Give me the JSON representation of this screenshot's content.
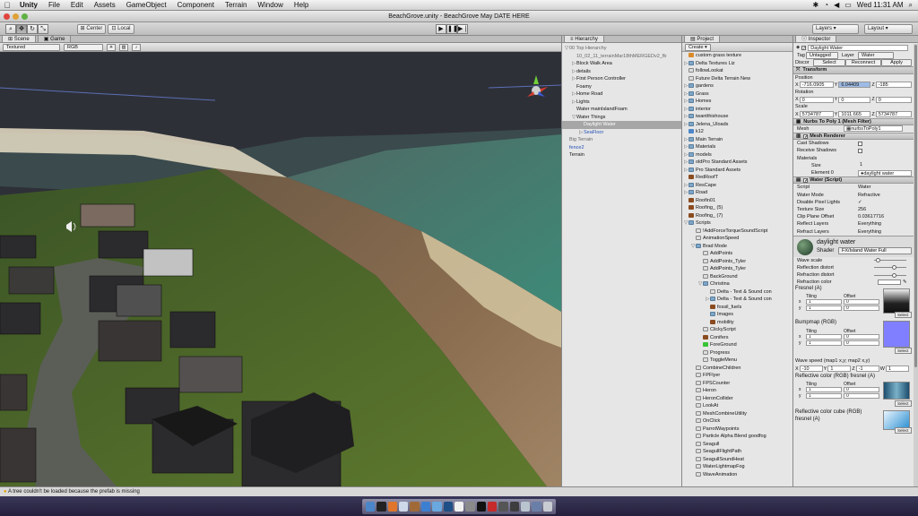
{
  "menubar": {
    "app": "Unity",
    "items": [
      "File",
      "Edit",
      "Assets",
      "GameObject",
      "Component",
      "Terrain",
      "Window",
      "Help"
    ],
    "clock": "Wed 11:31 AM"
  },
  "window": {
    "title": "BeachGrove.unity - BeachGrove May DATE HERE"
  },
  "toolbar": {
    "pivot": "Center",
    "space": "Local",
    "layers": "Layers",
    "layout": "Layout"
  },
  "scene": {
    "tabs": [
      "Scene",
      "Game"
    ],
    "draw_mode": "Textured",
    "render_mode": "RGB"
  },
  "hierarchy": {
    "title": "Hierarchy",
    "items": [
      {
        "text": "00 Top Hierarchy",
        "fold": "▽",
        "style": "gray",
        "indent": 0
      },
      {
        "text": "10_02_11_terrainMar18thMERGEDv2_fb",
        "fold": "",
        "style": "gray",
        "indent": 1
      },
      {
        "text": "Block Walk Area",
        "fold": "▷",
        "style": "",
        "indent": 1
      },
      {
        "text": "details",
        "fold": "▷",
        "style": "",
        "indent": 1
      },
      {
        "text": "First Person Controller",
        "fold": "▷",
        "style": "",
        "indent": 1
      },
      {
        "text": "Foamy",
        "fold": "",
        "style": "",
        "indent": 1
      },
      {
        "text": "Home Road",
        "fold": "▷",
        "style": "",
        "indent": 1
      },
      {
        "text": "Lights",
        "fold": "▷",
        "style": "",
        "indent": 1
      },
      {
        "text": "Water mainIslandFoam",
        "fold": "",
        "style": "",
        "indent": 1
      },
      {
        "text": "Water Things",
        "fold": "▽",
        "style": "",
        "indent": 1
      },
      {
        "text": "Daylight Water",
        "fold": "",
        "style": "sel",
        "indent": 2
      },
      {
        "text": "SeaFloor",
        "fold": "▷",
        "style": "blue",
        "indent": 2
      },
      {
        "text": "Big Terrain",
        "fold": "",
        "style": "gray",
        "indent": 0
      },
      {
        "text": "fence2",
        "fold": "",
        "style": "blue",
        "indent": 0
      },
      {
        "text": "Terrain",
        "fold": "",
        "style": "",
        "indent": 0
      }
    ]
  },
  "project": {
    "title": "Project",
    "create": "Create ▾",
    "items": [
      {
        "text": "custom grass texture",
        "fold": "",
        "icon": "tex",
        "indent": 0
      },
      {
        "text": "Delta Textures Liz",
        "fold": "▷",
        "icon": "folder",
        "indent": 0
      },
      {
        "text": "followLookat",
        "fold": "",
        "icon": "js",
        "indent": 0
      },
      {
        "text": "Future Delta Terrain New",
        "fold": "",
        "icon": "js",
        "indent": 0
      },
      {
        "text": "gardens",
        "fold": "▷",
        "icon": "folder",
        "indent": 0
      },
      {
        "text": "Grass",
        "fold": "▷",
        "icon": "folder",
        "indent": 0
      },
      {
        "text": "Homes",
        "fold": "▷",
        "icon": "folder",
        "indent": 0
      },
      {
        "text": "interior",
        "fold": "▷",
        "icon": "folder",
        "indent": 0
      },
      {
        "text": "iwantthishouse",
        "fold": "▷",
        "icon": "folder",
        "indent": 0
      },
      {
        "text": "Jelena_Uloads",
        "fold": "▷",
        "icon": "folder",
        "indent": 0
      },
      {
        "text": "k12",
        "fold": "",
        "icon": "pre",
        "indent": 0
      },
      {
        "text": "Main Terrain",
        "fold": "▷",
        "icon": "folder",
        "indent": 0
      },
      {
        "text": "Materials",
        "fold": "▷",
        "icon": "folder",
        "indent": 0
      },
      {
        "text": "models",
        "fold": "▷",
        "icon": "folder",
        "indent": 0
      },
      {
        "text": "oldPro Standard Assets",
        "fold": "▷",
        "icon": "folder",
        "indent": 0
      },
      {
        "text": "Pro Standard Assets",
        "fold": "▷",
        "icon": "folder",
        "indent": 0
      },
      {
        "text": "RedRoofT",
        "fold": "",
        "icon": "tex2",
        "indent": 0
      },
      {
        "text": "ResCape",
        "fold": "▷",
        "icon": "folder",
        "indent": 0
      },
      {
        "text": "Road",
        "fold": "▷",
        "icon": "folder",
        "indent": 0
      },
      {
        "text": "Roofin01",
        "fold": "",
        "icon": "tex2",
        "indent": 0
      },
      {
        "text": "Roofing_ (5)",
        "fold": "",
        "icon": "tex2",
        "indent": 0
      },
      {
        "text": "Roofing_ (7)",
        "fold": "",
        "icon": "tex2",
        "indent": 0
      },
      {
        "text": "Scripts",
        "fold": "▽",
        "icon": "folder",
        "indent": 0
      },
      {
        "text": "!AddForceTorqueSoundScript",
        "fold": "",
        "icon": "js",
        "indent": 1
      },
      {
        "text": "AnimationSpeed",
        "fold": "",
        "icon": "js",
        "indent": 1
      },
      {
        "text": "Brad Mode",
        "fold": "▽",
        "icon": "folder",
        "indent": 1
      },
      {
        "text": "AddPoints",
        "fold": "",
        "icon": "js",
        "indent": 2
      },
      {
        "text": "AddPoints_Tyler",
        "fold": "",
        "icon": "js",
        "indent": 2
      },
      {
        "text": "AddPoints_Tyler",
        "fold": "",
        "icon": "js",
        "indent": 2
      },
      {
        "text": "BackGround",
        "fold": "",
        "icon": "js",
        "indent": 2
      },
      {
        "text": "Christina",
        "fold": "▽",
        "icon": "folder",
        "indent": 2
      },
      {
        "text": "Delta - Text & Sound con",
        "fold": "",
        "icon": "js",
        "indent": 3
      },
      {
        "text": "Delta - Text & Sound con",
        "fold": "▷",
        "icon": "folder",
        "indent": 3
      },
      {
        "text": "fossil_fuels",
        "fold": "",
        "icon": "tex2",
        "indent": 3
      },
      {
        "text": "Images",
        "fold": "",
        "icon": "folder",
        "indent": 3
      },
      {
        "text": "mobility",
        "fold": "",
        "icon": "tex2",
        "indent": 3
      },
      {
        "text": "ClickyScript",
        "fold": "",
        "icon": "js",
        "indent": 2
      },
      {
        "text": "Conifers",
        "fold": "",
        "icon": "tex2",
        "indent": 2
      },
      {
        "text": "ForeGround",
        "fold": "",
        "icon": "green",
        "indent": 2
      },
      {
        "text": "Progress",
        "fold": "",
        "icon": "js",
        "indent": 2
      },
      {
        "text": "ToggleMenu",
        "fold": "",
        "icon": "js",
        "indent": 2
      },
      {
        "text": "CombineChildren",
        "fold": "",
        "icon": "js",
        "indent": 1
      },
      {
        "text": "FPFlyer",
        "fold": "",
        "icon": "js",
        "indent": 1
      },
      {
        "text": "FPSCounter",
        "fold": "",
        "icon": "js",
        "indent": 1
      },
      {
        "text": "Heron",
        "fold": "",
        "icon": "js",
        "indent": 1
      },
      {
        "text": "HeronCollider",
        "fold": "",
        "icon": "js",
        "indent": 1
      },
      {
        "text": "LookAt",
        "fold": "",
        "icon": "js",
        "indent": 1
      },
      {
        "text": "MeshCombineUtility",
        "fold": "",
        "icon": "js",
        "indent": 1
      },
      {
        "text": "OnClick",
        "fold": "",
        "icon": "js",
        "indent": 1
      },
      {
        "text": "ParrotWaypoints",
        "fold": "",
        "icon": "js",
        "indent": 1
      },
      {
        "text": "Particle Alpha Blend goodfog",
        "fold": "",
        "icon": "js",
        "indent": 1
      },
      {
        "text": "Seagull",
        "fold": "",
        "icon": "js",
        "indent": 1
      },
      {
        "text": "SeagullFlightPath",
        "fold": "",
        "icon": "js",
        "indent": 1
      },
      {
        "text": "SeagullSoundHeat",
        "fold": "",
        "icon": "js",
        "indent": 1
      },
      {
        "text": "WaterLightmapFog",
        "fold": "",
        "icon": "js",
        "indent": 1
      },
      {
        "text": "WaveAnimation",
        "fold": "",
        "icon": "js",
        "indent": 1
      }
    ]
  },
  "inspector": {
    "title": "Inspector",
    "object_name": "Daylight Water",
    "tag_label": "Tag",
    "tag": "Untagged",
    "layer_label": "Layer",
    "layer": "Water",
    "prefab_label": "Discor",
    "prefab_buttons": [
      "Select",
      "Reconnect",
      "Apply"
    ],
    "transform": {
      "title": "Transform",
      "position_label": "Position",
      "rotation_label": "Rotation",
      "scale_label": "Scale",
      "position": [
        "-716.0905",
        "6.04409",
        "-185"
      ],
      "rotation": [
        "0",
        "0",
        "0"
      ],
      "scale": [
        "5734787",
        "1011.665",
        "5734787"
      ]
    },
    "mesh_filter": {
      "title": "Nurbs To Poly 1 (Mesh Filter)",
      "mesh_label": "Mesh",
      "mesh": "nurbsToPoly1"
    },
    "mesh_renderer": {
      "title": "Mesh Renderer",
      "cast": "Cast Shadows",
      "receive": "Receive Shadows",
      "materials": "Materials",
      "size_label": "Size",
      "size": "1",
      "element_label": "Element 0",
      "element": "daylight water"
    },
    "water": {
      "title": "Water (Script)",
      "rows": [
        {
          "label": "Script",
          "value": "Water"
        },
        {
          "label": "Water Mode",
          "value": "Refractive"
        },
        {
          "label": "Disable Pixel Lights",
          "value": "✓"
        },
        {
          "label": "Texture Size",
          "value": "256"
        },
        {
          "label": "Clip Plane Offset",
          "value": "0.03617716"
        },
        {
          "label": "Reflect Layers",
          "value": "Everything"
        },
        {
          "label": "Refract Layers",
          "value": "Everything"
        }
      ]
    },
    "material": {
      "name": "daylight water",
      "shader_label": "Shader",
      "shader": "FX/Island Water Full",
      "wave_scale": "Wave scale",
      "refl_distort": "Reflection distort",
      "refr_distort": "Refraction distort",
      "refr_color": "Refraction color",
      "fresnel": "Fresnel (A)",
      "tiling": "Tiling",
      "offset": "Offset",
      "x": "x",
      "y": "y",
      "one": "1",
      "zero": "0",
      "select": "Select",
      "bumpmap": "Bumpmap (RGB)",
      "wave_speed": "Wave speed (map1 x,y; map2 x,y)",
      "ws_x": "-10",
      "ws_y": "1",
      "ws_z": "-1",
      "ws_w": "1",
      "X": "X",
      "Y": "Y",
      "Z": "Z",
      "W": "W",
      "refl_fresnel": "Reflective color (RGB) fresnel (A)",
      "refl_cube": "Reflective color cube (RGB) fresnel (A)",
      "colors": {
        "bump": "#7f7fff",
        "fresnel_gray": "#6c6c6c",
        "cube": "#2b8fd0"
      }
    }
  },
  "status": {
    "message": "A tree couldn't be loaded because the prefab is missing"
  }
}
